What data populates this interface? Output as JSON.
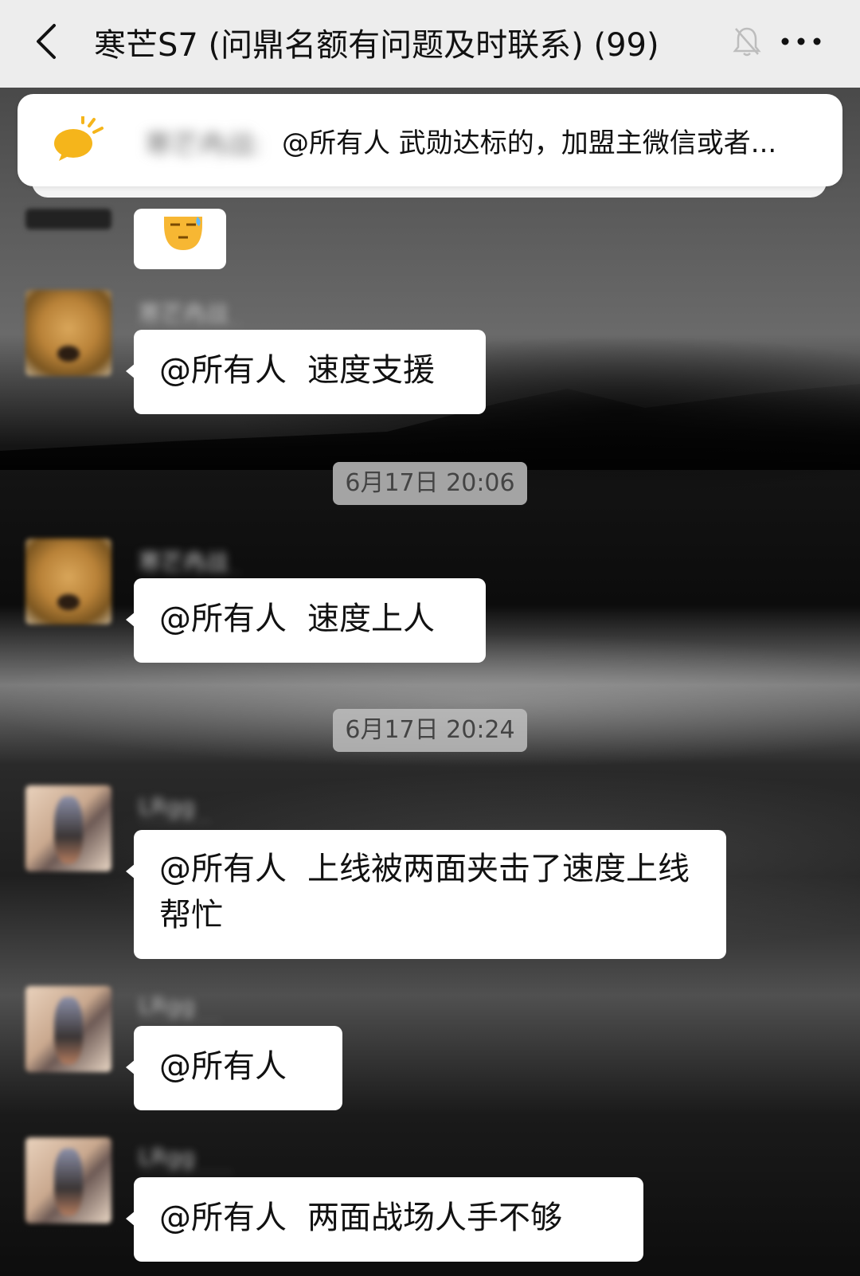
{
  "header": {
    "title": "寒芒S7 (问鼎名额有问题及时联系) (99)",
    "back_icon": "chevron-left-icon",
    "mute_icon": "bell-off-icon",
    "more_icon": "more-dots-icon"
  },
  "pinned": {
    "icon": "megaphone-icon",
    "sender": "寒芒冉战:",
    "text": "@所有人 武勋达标的，加盟主微信或者..."
  },
  "messages": [
    {
      "type": "emoji",
      "emoji": "sleepy-face-icon"
    },
    {
      "sender": "寒芒冉战",
      "mention": "@所有人",
      "text": "速度支援"
    },
    {
      "type": "time",
      "text": "6月17日 20:06"
    },
    {
      "sender": "寒芒冉战",
      "mention": "@所有人",
      "text": "速度上人"
    },
    {
      "type": "time",
      "text": "6月17日 20:24"
    },
    {
      "sender": "LRgg",
      "mention": "@所有人",
      "text": "上线被两面夹击了速度上线帮忙"
    },
    {
      "sender": "LRgg",
      "mention": "@所有人",
      "text": ""
    },
    {
      "sender": "LRgg",
      "mention": "@所有人",
      "text": "两面战场人手不够"
    }
  ],
  "colors": {
    "header_bg": "#ededed",
    "bubble_bg": "#ffffff",
    "time_bg": "#bebebe",
    "megaphone": "#f5b51b"
  }
}
